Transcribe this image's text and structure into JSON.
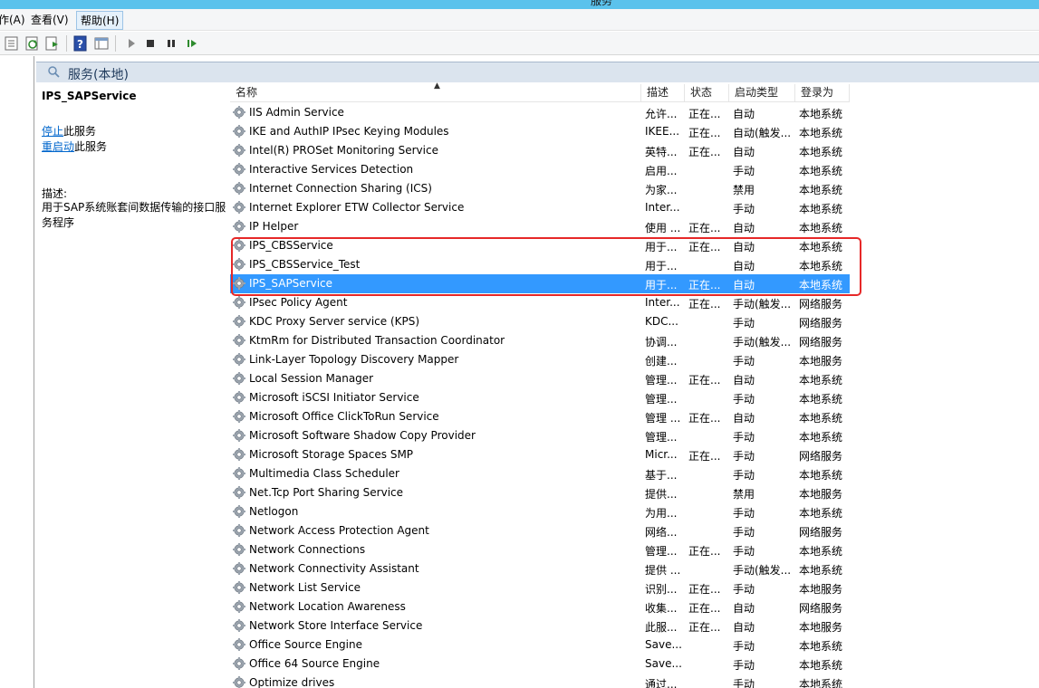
{
  "window": {
    "title": "服务"
  },
  "menu": {
    "items": [
      "作(A)",
      "查看(V)",
      "帮助(H)"
    ]
  },
  "header": {
    "title": "服务(本地)"
  },
  "detail": {
    "service_name": "IPS_SAPService",
    "stop_link": "停止",
    "stop_suffix": "此服务",
    "restart_link": "重启动",
    "restart_suffix": "此服务",
    "desc_label": "描述:",
    "desc_text": "用于SAP系统账套间数据传输的接口服务程序"
  },
  "columns": {
    "name": "名称",
    "desc": "描述",
    "status": "状态",
    "startup": "启动类型",
    "logon": "登录为"
  },
  "services": [
    {
      "name": "IIS Admin Service",
      "desc": "允许...",
      "status": "正在...",
      "startup": "自动",
      "logon": "本地系统"
    },
    {
      "name": "IKE and AuthIP IPsec Keying Modules",
      "desc": "IKEE...",
      "status": "正在...",
      "startup": "自动(触发...",
      "logon": "本地系统"
    },
    {
      "name": "Intel(R) PROSet Monitoring Service",
      "desc": "英特...",
      "status": "正在...",
      "startup": "自动",
      "logon": "本地系统"
    },
    {
      "name": "Interactive Services Detection",
      "desc": "启用...",
      "status": "",
      "startup": "手动",
      "logon": "本地系统"
    },
    {
      "name": "Internet Connection Sharing (ICS)",
      "desc": "为家...",
      "status": "",
      "startup": "禁用",
      "logon": "本地系统"
    },
    {
      "name": "Internet Explorer ETW Collector Service",
      "desc": "Inter...",
      "status": "",
      "startup": "手动",
      "logon": "本地系统"
    },
    {
      "name": "IP Helper",
      "desc": "使用 ...",
      "status": "正在...",
      "startup": "自动",
      "logon": "本地系统"
    },
    {
      "name": "IPS_CBSService",
      "desc": "用于...",
      "status": "正在...",
      "startup": "自动",
      "logon": "本地系统"
    },
    {
      "name": "IPS_CBSService_Test",
      "desc": "用于...",
      "status": "",
      "startup": "自动",
      "logon": "本地系统"
    },
    {
      "name": "IPS_SAPService",
      "desc": "用于...",
      "status": "正在...",
      "startup": "自动",
      "logon": "本地系统",
      "selected": true
    },
    {
      "name": "IPsec Policy Agent",
      "desc": "Inter...",
      "status": "正在...",
      "startup": "手动(触发...",
      "logon": "网络服务"
    },
    {
      "name": "KDC Proxy Server service (KPS)",
      "desc": "KDC...",
      "status": "",
      "startup": "手动",
      "logon": "网络服务"
    },
    {
      "name": "KtmRm for Distributed Transaction Coordinator",
      "desc": "协调...",
      "status": "",
      "startup": "手动(触发...",
      "logon": "网络服务"
    },
    {
      "name": "Link-Layer Topology Discovery Mapper",
      "desc": "创建...",
      "status": "",
      "startup": "手动",
      "logon": "本地服务"
    },
    {
      "name": "Local Session Manager",
      "desc": "管理...",
      "status": "正在...",
      "startup": "自动",
      "logon": "本地系统"
    },
    {
      "name": "Microsoft iSCSI Initiator Service",
      "desc": "管理...",
      "status": "",
      "startup": "手动",
      "logon": "本地系统"
    },
    {
      "name": "Microsoft Office ClickToRun Service",
      "desc": "管理 ...",
      "status": "正在...",
      "startup": "自动",
      "logon": "本地系统"
    },
    {
      "name": "Microsoft Software Shadow Copy Provider",
      "desc": "管理...",
      "status": "",
      "startup": "手动",
      "logon": "本地系统"
    },
    {
      "name": "Microsoft Storage Spaces SMP",
      "desc": "Micr...",
      "status": "正在...",
      "startup": "手动",
      "logon": "网络服务"
    },
    {
      "name": "Multimedia Class Scheduler",
      "desc": "基于...",
      "status": "",
      "startup": "手动",
      "logon": "本地系统"
    },
    {
      "name": "Net.Tcp Port Sharing Service",
      "desc": "提供...",
      "status": "",
      "startup": "禁用",
      "logon": "本地服务"
    },
    {
      "name": "Netlogon",
      "desc": "为用...",
      "status": "",
      "startup": "手动",
      "logon": "本地系统"
    },
    {
      "name": "Network Access Protection Agent",
      "desc": "网络...",
      "status": "",
      "startup": "手动",
      "logon": "网络服务"
    },
    {
      "name": "Network Connections",
      "desc": "管理...",
      "status": "正在...",
      "startup": "手动",
      "logon": "本地系统"
    },
    {
      "name": "Network Connectivity Assistant",
      "desc": "提供 ...",
      "status": "",
      "startup": "手动(触发...",
      "logon": "本地系统"
    },
    {
      "name": "Network List Service",
      "desc": "识别...",
      "status": "正在...",
      "startup": "手动",
      "logon": "本地服务"
    },
    {
      "name": "Network Location Awareness",
      "desc": "收集...",
      "status": "正在...",
      "startup": "自动",
      "logon": "网络服务"
    },
    {
      "name": "Network Store Interface Service",
      "desc": "此服...",
      "status": "正在...",
      "startup": "自动",
      "logon": "本地服务"
    },
    {
      "name": "Office  Source Engine",
      "desc": "Save...",
      "status": "",
      "startup": "手动",
      "logon": "本地系统"
    },
    {
      "name": "Office 64 Source Engine",
      "desc": "Save...",
      "status": "",
      "startup": "手动",
      "logon": "本地系统"
    },
    {
      "name": "Optimize drives",
      "desc": "通过...",
      "status": "",
      "startup": "手动",
      "logon": "本地系统"
    }
  ],
  "icons": {
    "toolbar": [
      "properties-icon",
      "refresh-icon",
      "export-icon",
      "help-icon",
      "view-icon",
      "start-icon",
      "stop-icon",
      "pause-icon",
      "resume-icon"
    ],
    "row": "gear-icon",
    "header": "search-icon"
  },
  "colors": {
    "selection": "#3399ff",
    "highlight_box": "#e62828",
    "link": "#0066cc"
  }
}
